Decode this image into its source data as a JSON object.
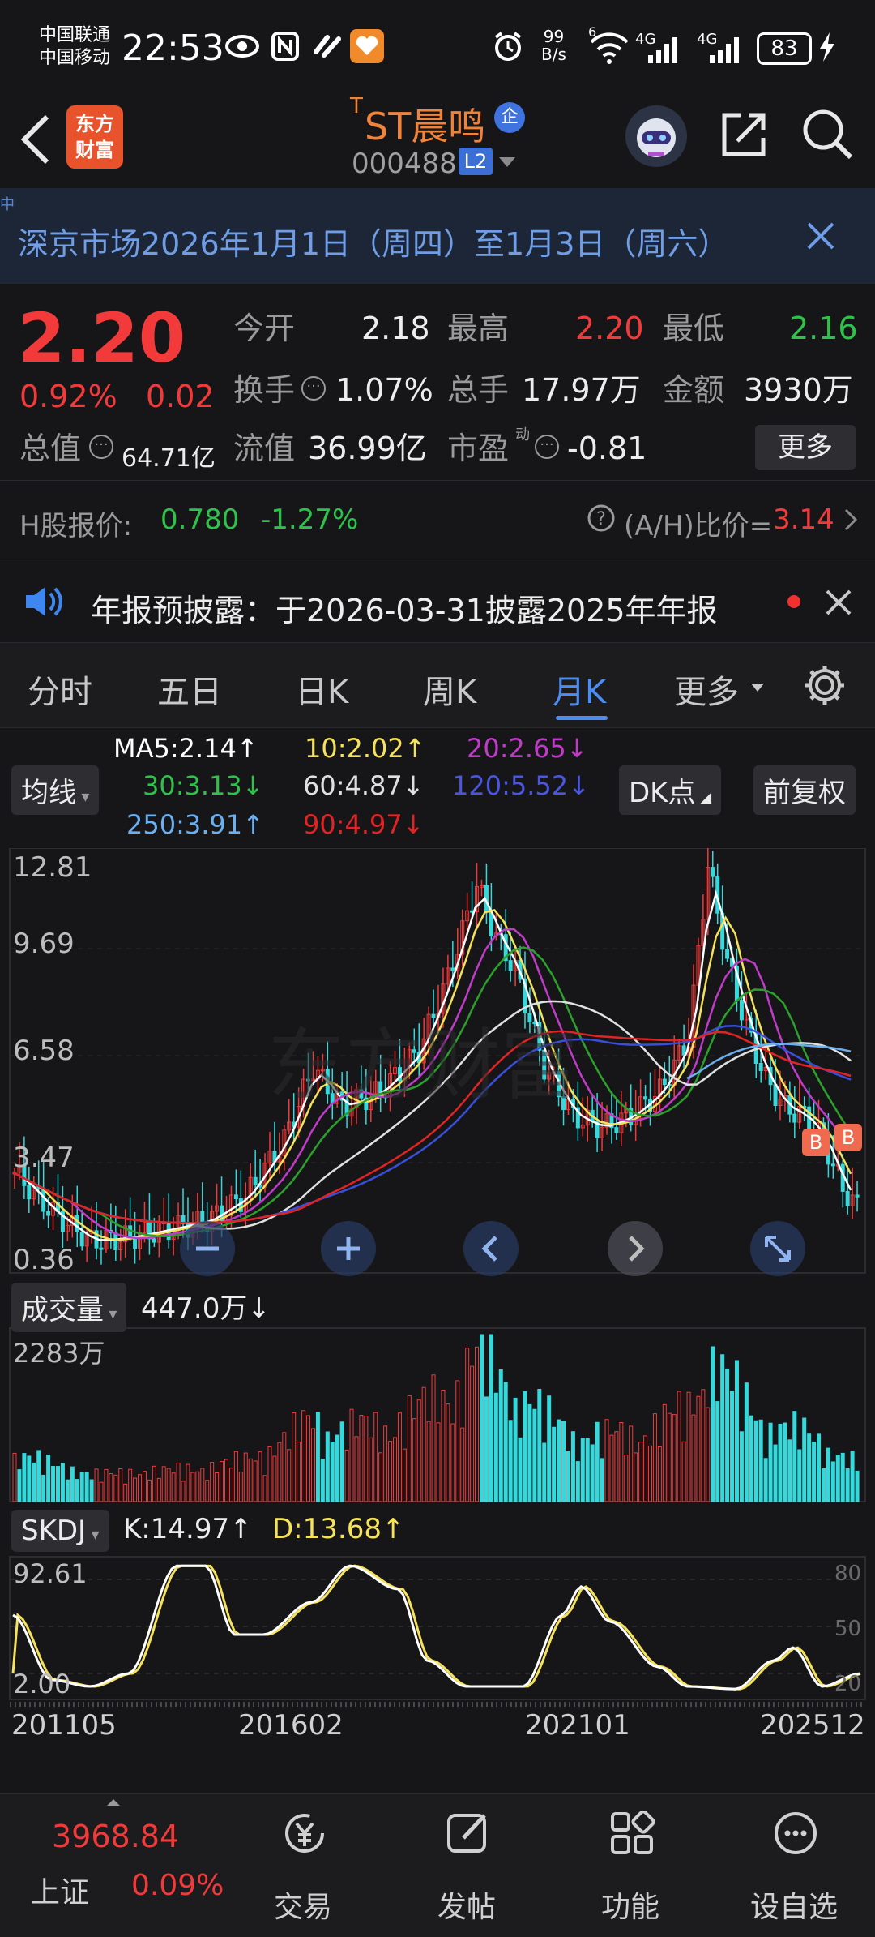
{
  "status_bar": {
    "carrier1": "中国联通",
    "carrier2": "中国移动",
    "time": "22:53",
    "net_speed_top": "99",
    "net_speed_bottom": "B/s",
    "wifi_tag": "6",
    "signal1": "4G",
    "signal2": "4G",
    "battery": "83"
  },
  "header": {
    "app_logo_line1": "东方",
    "app_logo_line2": "财富",
    "stock_prefix": "T",
    "stock_name": "ST晨鸣",
    "badge": "企",
    "stock_code": "000488",
    "level": "L2"
  },
  "banner": {
    "text": "深京市场2026年1月1日（周四）至1月3日（周六）"
  },
  "quote": {
    "price": "2.20",
    "change_pct": "0.92%",
    "change": "0.02",
    "open_label": "今开",
    "open": "2.18",
    "high_label": "最高",
    "high": "2.20",
    "low_label": "最低",
    "low": "2.16",
    "turnover_label": "换手",
    "turnover": "1.07%",
    "volume_label": "总手",
    "volume": "17.97万",
    "amount_label": "金额",
    "amount": "3930万",
    "mktcap_label": "总值",
    "mktcap": "64.71亿",
    "float_label": "流值",
    "float": "36.99亿",
    "pe_label": "市盈",
    "pe_sup": "动",
    "pe": "-0.81",
    "more_button": "更多"
  },
  "h_share": {
    "label": "H股报价:",
    "price": "0.780",
    "change": "-1.27%",
    "ratio_label": "(A/H)比价=",
    "ratio": "3.14"
  },
  "notice": {
    "text": "年报预披露：于2026-03-31披露2025年年报"
  },
  "tabs": [
    "分时",
    "五日",
    "日K",
    "周K",
    "月K",
    "更多"
  ],
  "active_tab": 4,
  "ma_panel": {
    "selector": "均线",
    "ma5": "MA5:2.14↑",
    "ma10": "10:2.02↑",
    "ma20": "20:2.65↓",
    "ma30": "30:3.13↓",
    "ma60": "60:4.87↓",
    "ma120": "120:5.52↓",
    "ma250": "250:3.91↑",
    "ma90": "90:4.97↓",
    "dk_button": "DK点",
    "adjust_button": "前复权"
  },
  "kline": {
    "y_labels": [
      "12.81",
      "9.69",
      "6.58",
      "3.47",
      "0.36"
    ],
    "marker_b": "B",
    "watermark": "东方财富"
  },
  "volume_panel": {
    "selector": "成交量",
    "value": "447.0万↓",
    "max_label": "2283万"
  },
  "skdj_panel": {
    "selector": "SKDJ",
    "k_value": "K:14.97↑",
    "d_value": "D:13.68↑",
    "left_top": "92.61",
    "left_bottom": "2.00",
    "right_labels": [
      "80",
      "50",
      "20"
    ]
  },
  "x_axis": [
    "201105",
    "201602",
    "202101",
    "202512"
  ],
  "bottom_nav": {
    "index_value": "3968.84",
    "index_name": "上证",
    "index_change": "0.09%",
    "items": [
      "交易",
      "发帖",
      "功能",
      "设自选"
    ]
  },
  "colors": {
    "up": "#f23a3a",
    "down": "#2ec24a",
    "accent": "#4a8ef5",
    "ma5": "#ffffff",
    "ma10": "#f5e25a",
    "ma20": "#c03cc8",
    "ma30": "#2ca02c",
    "ma60": "#e0e0e0",
    "ma120": "#3a4fd8",
    "ma250": "#6aaff0",
    "ma90": "#e02424"
  }
}
